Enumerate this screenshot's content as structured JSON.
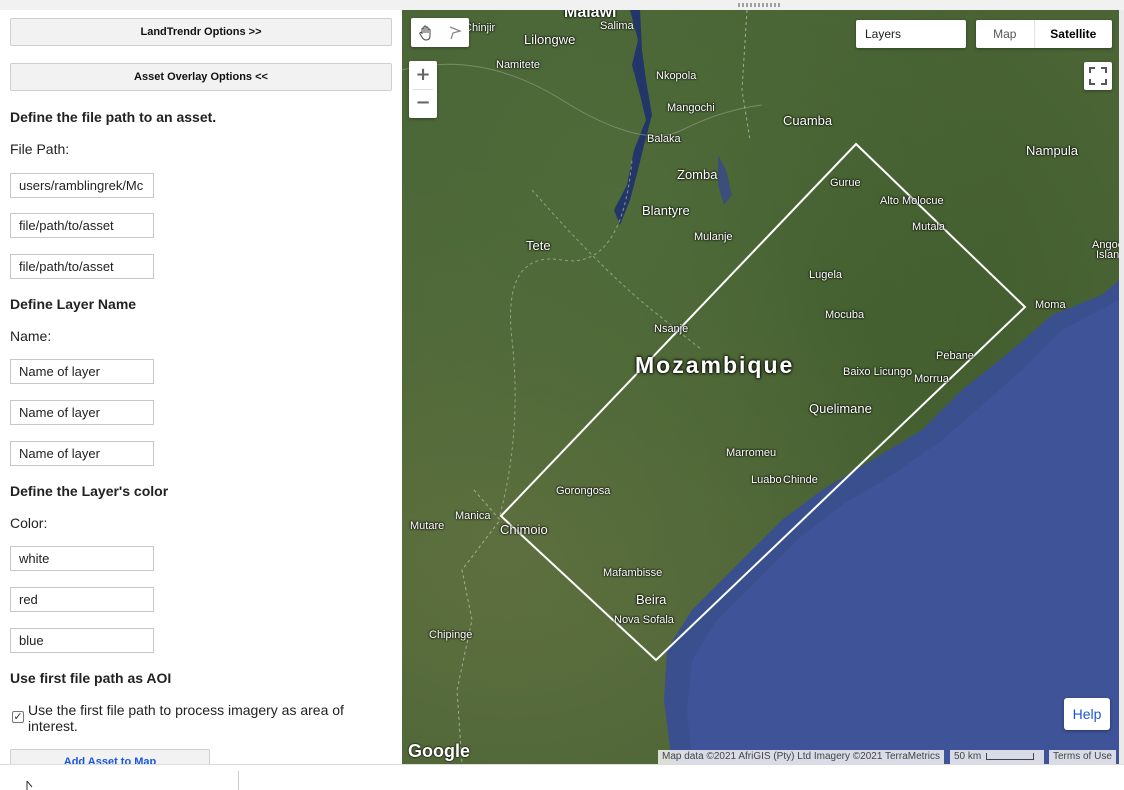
{
  "panel": {
    "landtrendr_button": "LandTrendr Options >>",
    "asset_overlay_button": "Asset Overlay Options <<",
    "file_heading": "Define the file path to an asset.",
    "file_label": "File Path:",
    "file_paths": [
      "users/ramblingrek/Mc",
      "file/path/to/asset",
      "file/path/to/asset"
    ],
    "layer_heading": "Define Layer Name",
    "layer_label": "Name:",
    "layer_names": [
      "Name of layer",
      "Name of layer",
      "Name of layer"
    ],
    "color_heading": "Define the Layer's color",
    "color_label": "Color:",
    "colors": [
      "white",
      "red",
      "blue"
    ],
    "aoi_heading": "Use first file path as AOI",
    "aoi_checkbox_checked": true,
    "aoi_checkbox_label": "Use the first file path to process imagery as area of interest.",
    "add_button": "Add Asset to Map"
  },
  "map": {
    "layers_label": "Layers",
    "map_type_options": [
      "Map",
      "Satellite"
    ],
    "map_type_selected": "Satellite",
    "zoom_in": "+",
    "zoom_out": "−",
    "help_button": "Help",
    "google_logo": "Google",
    "attribution": "Map data ©2021 AfriGIS (Pty) Ltd Imagery ©2021 TerraMetrics",
    "scale": "50 km",
    "terms": "Terms of Use",
    "country_label": "Mozambique",
    "places": [
      "Malawi",
      "Lilongwe",
      "Salima",
      "Namitete",
      "Nkopola",
      "Mangochi",
      "Balaka",
      "Zomba",
      "Blantyre",
      "Mulanje",
      "Tete",
      "Cuamba",
      "Nampula",
      "Gurue",
      "Alto Molocue",
      "Mutala",
      "Lugela",
      "Mocuba",
      "Nsanje",
      "Moma",
      "Pebane",
      "Baixo Licungo",
      "Morrua",
      "Quelimane",
      "Marromeu",
      "Luabo",
      "Chinde",
      "Gorongosa",
      "Manica",
      "Mutare",
      "Chimoio",
      "Mafambisse",
      "Beira",
      "Nova Sofala",
      "Chipinge",
      "Chinjir",
      "Angoc",
      "Islan"
    ]
  },
  "icons": {
    "pan": "hand-icon",
    "draw": "flag-icon",
    "fullscreen": "fullscreen-icon",
    "checkbox": "checkbox-icon"
  }
}
